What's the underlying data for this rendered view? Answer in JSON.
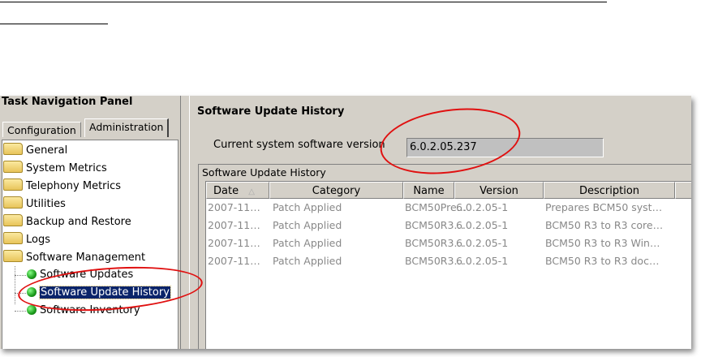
{
  "left_panel": {
    "title": "Task Navigation Panel",
    "tabs": [
      "Configuration",
      "Administration"
    ],
    "tree": [
      "General",
      "System Metrics",
      "Telephony Metrics",
      "Utilities",
      "Backup and Restore",
      "Logs",
      "Software Management"
    ],
    "children": [
      "Software Updates",
      "Software Update History",
      "Software Inventory"
    ]
  },
  "main": {
    "title": "Software Update History",
    "version_label": "Current system software version",
    "version_value": "6.0.2.05.237",
    "group_label": "Software Update History",
    "columns": [
      "Date",
      "Category",
      "Name",
      "Version",
      "Description"
    ],
    "rows": [
      [
        "2007-11…",
        "Patch Applied",
        "BCM50Pre…",
        "6.0.2.05-1",
        "Prepares BCM50 syst…"
      ],
      [
        "2007-11…",
        "Patch Applied",
        "BCM50R3…",
        "6.0.2.05-1",
        "BCM50 R3 to R3 core…"
      ],
      [
        "2007-11…",
        "Patch Applied",
        "BCM50R3…",
        "6.0.2.05-1",
        "BCM50 R3 to R3 Win…"
      ],
      [
        "2007-11…",
        "Patch Applied",
        "BCM50R3…",
        "6.0.2.05-1",
        "BCM50 R3 to R3 doc…"
      ]
    ]
  },
  "colors": {
    "selection": "#0a246a",
    "highlight_circle": "#e01010"
  }
}
